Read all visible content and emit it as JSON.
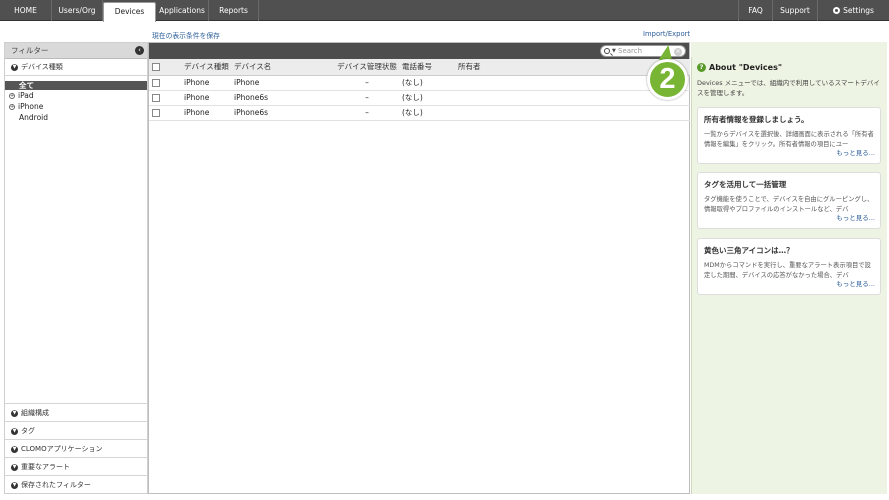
{
  "nav": {
    "tabs": [
      "HOME",
      "Users/Org",
      "Devices",
      "Applications",
      "Reports"
    ],
    "active_tab": "Devices",
    "right": [
      "FAQ",
      "Support",
      "Settings"
    ]
  },
  "links": {
    "save_filter": "現在の表示条件を保存",
    "import_export": "Import/Export"
  },
  "filter": {
    "title": "フィルター",
    "device_type_header": "デバイス種類",
    "items": [
      "全て",
      "iPad",
      "iPhone",
      "Android"
    ],
    "bottom_sections": [
      "組織構成",
      "タグ",
      "CLOMOアプリケーション",
      "重要なアラート",
      "保存されたフィルター"
    ]
  },
  "search": {
    "placeholder": "Search"
  },
  "table": {
    "columns": [
      "デバイス種類",
      "デバイス名",
      "デバイス管理状態",
      "電話番号",
      "所有者"
    ],
    "rows": [
      [
        "iPhone",
        "iPhone",
        "–",
        "(なし)",
        ""
      ],
      [
        "iPhone",
        "iPhone6s",
        "–",
        "(なし)",
        ""
      ],
      [
        "iPhone",
        "iPhone6s",
        "–",
        "(なし)",
        ""
      ]
    ]
  },
  "badge": "2",
  "about": {
    "title": "About \"Devices\"",
    "desc": "Devices メニューでは、組織内で利用しているスマートデバイスを管理します。",
    "cards": [
      {
        "title": "所有者情報を登録しましょう。",
        "text": "一覧からデバイスを選択後、詳細画面に表示される「所有者情報を編集」をクリック。所有者情報の項目にユー",
        "more": "もっと見る..."
      },
      {
        "title": "タグを活用して一括管理",
        "text": "タグ機能を使うことで、デバイスを自由にグルーピングし、情報取得やプロファイルのインストールなど、デバ",
        "more": "もっと見る..."
      },
      {
        "title": "黄色い三角アイコンは…？",
        "text": "MDMからコマンドを実行し、重要なアラート表示項目で設定した期間、デバイスの応答がなかった場合、デバ",
        "more": "もっと見る..."
      }
    ]
  }
}
